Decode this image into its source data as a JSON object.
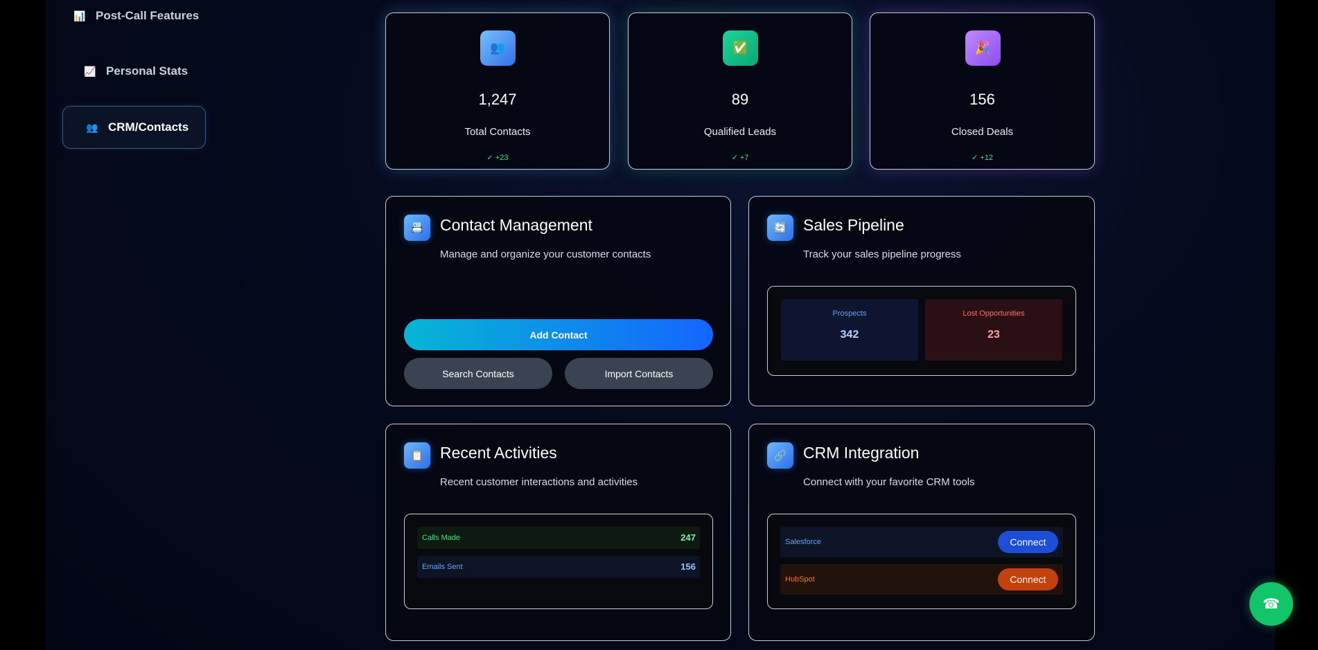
{
  "sidebar": {
    "items": [
      {
        "label": "Post-Call Features",
        "icon": "bar-chart-icon",
        "glyph": "📊"
      },
      {
        "label": "Personal Stats",
        "icon": "chart-trend-icon",
        "glyph": "📈"
      },
      {
        "label": "CRM/Contacts",
        "icon": "people-icon",
        "glyph": "👥",
        "active": true
      }
    ]
  },
  "stats": [
    {
      "value": "1,247",
      "label": "Total Contacts",
      "change": "✓ +23",
      "icon": "people-icon",
      "glyph": "👥",
      "color": "#3b82f6"
    },
    {
      "value": "89",
      "label": "Qualified Leads",
      "change": "✓ +7",
      "icon": "checkmark-icon",
      "glyph": "✅",
      "color": "#10b981"
    },
    {
      "value": "156",
      "label": "Closed Deals",
      "change": "✓ +12",
      "icon": "celebration-icon",
      "glyph": "🎉",
      "color": "#a855f7"
    }
  ],
  "contact_management": {
    "title": "Contact Management",
    "description": "Manage and organize your customer contacts",
    "icon_glyph": "📇",
    "add_label": "Add Contact",
    "search_label": "Search Contacts",
    "import_label": "Import Contacts"
  },
  "sales_pipeline": {
    "title": "Sales Pipeline",
    "description": "Track your sales pipeline progress",
    "icon_glyph": "🔄",
    "prospects_label": "Prospects",
    "prospects_value": "342",
    "lost_label": "Lost Opportunities",
    "lost_value": "23"
  },
  "recent_activities": {
    "title": "Recent Activities",
    "description": "Recent customer interactions and activities",
    "icon_glyph": "📋",
    "rows": [
      {
        "label": "Calls Made",
        "value": "247"
      },
      {
        "label": "Emails Sent",
        "value": "156"
      }
    ]
  },
  "crm_integration": {
    "title": "CRM Integration",
    "description": "Connect with your favorite CRM tools",
    "icon_glyph": "🔗",
    "rows": [
      {
        "label": "Salesforce",
        "button": "Connect"
      },
      {
        "label": "HubSpot",
        "button": "Connect"
      }
    ]
  },
  "fab": {
    "icon": "phone-icon",
    "glyph": "☎"
  }
}
